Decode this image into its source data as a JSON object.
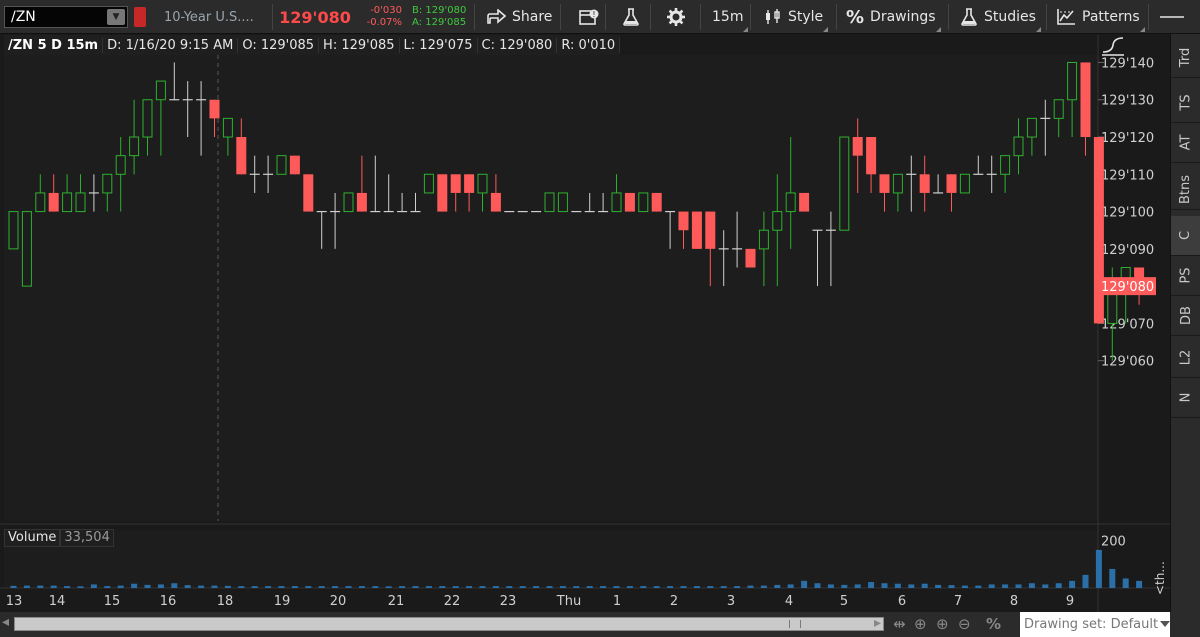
{
  "toolbar": {
    "symbol": "/ZN",
    "description": "10-Year U.S....",
    "last_price": "129'080",
    "change_net": "-0'030",
    "change_pct": "-0.07%",
    "bid": "B: 129'080",
    "ask": "A: 129'085",
    "share_label": "Share",
    "timeframe_label": "15m",
    "style_label": "Style",
    "drawings_label": "Drawings",
    "studies_label": "Studies",
    "patterns_label": "Patterns"
  },
  "chart_header": {
    "title": "/ZN 5 D 15m",
    "date": "D: 1/16/20 9:15 AM",
    "open": "O: 129'085",
    "high": "H: 129'085",
    "low": "L: 129'075",
    "close": "C: 129'080",
    "range": "R: 0'010"
  },
  "volume_header": {
    "label": "Volume",
    "value": "33,504"
  },
  "side_panel": {
    "tabs": [
      "Trd",
      "TS",
      "AT",
      "Btns",
      "C",
      "PS",
      "DB",
      "L2",
      "N"
    ],
    "selected": "C"
  },
  "bottom_bar": {
    "drawing_set": "Drawing set: Default"
  },
  "vol_axis_tick_labels": [
    "200",
    "<th..."
  ],
  "colors": {
    "up": "#2fb12f",
    "down": "#ff5a5a",
    "doji": "#cfcfcf",
    "volume": "#2a6fa8",
    "last_price_tag": "#ff5a5a"
  },
  "chart_data": {
    "type": "candlestick",
    "price_tick_labels": [
      "129'140",
      "129'130",
      "129'120",
      "129'110",
      "129'100",
      "129'090",
      "129'080",
      "129'070",
      "129'060"
    ],
    "price_ylim": [
      129.053125,
      129.44375
    ],
    "last_price_tag": "129'080",
    "x_tick_labels": [
      "13",
      "14",
      "15",
      "16",
      "18",
      "19",
      "20",
      "21",
      "22",
      "23",
      "Thu",
      "1",
      "2",
      "3",
      "4",
      "5",
      "6",
      "7",
      "8",
      "9"
    ],
    "volume_ylim": [
      0,
      235
    ],
    "candles": [
      {
        "o": 129.28125,
        "h": 129.3125,
        "l": 129.28125,
        "c": 129.3125
      },
      {
        "o": 129.25,
        "h": 129.3125,
        "l": 129.25,
        "c": 129.3125
      },
      {
        "o": 129.3125,
        "h": 129.34375,
        "l": 129.3125,
        "c": 129.328125
      },
      {
        "o": 129.328125,
        "h": 129.34375,
        "l": 129.3125,
        "c": 129.3125
      },
      {
        "o": 129.3125,
        "h": 129.34375,
        "l": 129.3125,
        "c": 129.328125
      },
      {
        "o": 129.3125,
        "h": 129.34375,
        "l": 129.3125,
        "c": 129.328125
      },
      {
        "o": 129.328125,
        "h": 129.34375,
        "l": 129.3125,
        "c": 129.328125
      },
      {
        "o": 129.328125,
        "h": 129.34375,
        "l": 129.3125,
        "c": 129.34375
      },
      {
        "o": 129.34375,
        "h": 129.375,
        "l": 129.3125,
        "c": 129.359375
      },
      {
        "o": 129.359375,
        "h": 129.40625,
        "l": 129.34375,
        "c": 129.375
      },
      {
        "o": 129.375,
        "h": 129.40625,
        "l": 129.359375,
        "c": 129.40625
      },
      {
        "o": 129.40625,
        "h": 129.421875,
        "l": 129.359375,
        "c": 129.421875
      },
      {
        "o": 129.40625,
        "h": 129.4375,
        "l": 129.40625,
        "c": 129.40625
      },
      {
        "o": 129.40625,
        "h": 129.421875,
        "l": 129.375,
        "c": 129.40625
      },
      {
        "o": 129.40625,
        "h": 129.421875,
        "l": 129.359375,
        "c": 129.40625
      },
      {
        "o": 129.40625,
        "h": 129.40625,
        "l": 129.375,
        "c": 129.390625
      },
      {
        "o": 129.375,
        "h": 129.390625,
        "l": 129.359375,
        "c": 129.390625
      },
      {
        "o": 129.375,
        "h": 129.390625,
        "l": 129.34375,
        "c": 129.34375
      },
      {
        "o": 129.34375,
        "h": 129.359375,
        "l": 129.328125,
        "c": 129.34375
      },
      {
        "o": 129.34375,
        "h": 129.359375,
        "l": 129.328125,
        "c": 129.34375
      },
      {
        "o": 129.34375,
        "h": 129.359375,
        "l": 129.34375,
        "c": 129.359375
      },
      {
        "o": 129.359375,
        "h": 129.359375,
        "l": 129.34375,
        "c": 129.34375
      },
      {
        "o": 129.34375,
        "h": 129.34375,
        "l": 129.3125,
        "c": 129.3125
      },
      {
        "o": 129.3125,
        "h": 129.3125,
        "l": 129.28125,
        "c": 129.3125
      },
      {
        "o": 129.3125,
        "h": 129.328125,
        "l": 129.28125,
        "c": 129.3125
      },
      {
        "o": 129.3125,
        "h": 129.328125,
        "l": 129.3125,
        "c": 129.328125
      },
      {
        "o": 129.328125,
        "h": 129.359375,
        "l": 129.3125,
        "c": 129.3125
      },
      {
        "o": 129.3125,
        "h": 129.359375,
        "l": 129.3125,
        "c": 129.3125
      },
      {
        "o": 129.3125,
        "h": 129.34375,
        "l": 129.3125,
        "c": 129.3125
      },
      {
        "o": 129.3125,
        "h": 129.328125,
        "l": 129.3125,
        "c": 129.3125
      },
      {
        "o": 129.3125,
        "h": 129.328125,
        "l": 129.3125,
        "c": 129.3125
      },
      {
        "o": 129.328125,
        "h": 129.34375,
        "l": 129.328125,
        "c": 129.34375
      },
      {
        "o": 129.34375,
        "h": 129.34375,
        "l": 129.3125,
        "c": 129.3125
      },
      {
        "o": 129.34375,
        "h": 129.34375,
        "l": 129.3125,
        "c": 129.328125
      },
      {
        "o": 129.34375,
        "h": 129.34375,
        "l": 129.3125,
        "c": 129.328125
      },
      {
        "o": 129.328125,
        "h": 129.34375,
        "l": 129.3125,
        "c": 129.34375
      },
      {
        "o": 129.328125,
        "h": 129.34375,
        "l": 129.3125,
        "c": 129.3125
      },
      {
        "o": 129.3125,
        "h": 129.3125,
        "l": 129.3125,
        "c": 129.3125
      },
      {
        "o": 129.3125,
        "h": 129.3125,
        "l": 129.3125,
        "c": 129.3125
      },
      {
        "o": 129.3125,
        "h": 129.3125,
        "l": 129.3125,
        "c": 129.3125
      },
      {
        "o": 129.3125,
        "h": 129.328125,
        "l": 129.3125,
        "c": 129.328125
      },
      {
        "o": 129.3125,
        "h": 129.328125,
        "l": 129.3125,
        "c": 129.328125
      },
      {
        "o": 129.3125,
        "h": 129.3125,
        "l": 129.3125,
        "c": 129.3125
      },
      {
        "o": 129.3125,
        "h": 129.328125,
        "l": 129.3125,
        "c": 129.3125
      },
      {
        "o": 129.3125,
        "h": 129.328125,
        "l": 129.3125,
        "c": 129.3125
      },
      {
        "o": 129.3125,
        "h": 129.34375,
        "l": 129.3125,
        "c": 129.328125
      },
      {
        "o": 129.328125,
        "h": 129.328125,
        "l": 129.3125,
        "c": 129.3125
      },
      {
        "o": 129.3125,
        "h": 129.328125,
        "l": 129.3125,
        "c": 129.328125
      },
      {
        "o": 129.328125,
        "h": 129.328125,
        "l": 129.3125,
        "c": 129.3125
      },
      {
        "o": 129.3125,
        "h": 129.3125,
        "l": 129.28125,
        "c": 129.3125
      },
      {
        "o": 129.3125,
        "h": 129.3125,
        "l": 129.28125,
        "c": 129.296875
      },
      {
        "o": 129.3125,
        "h": 129.3125,
        "l": 129.28125,
        "c": 129.28125
      },
      {
        "o": 129.3125,
        "h": 129.3125,
        "l": 129.25,
        "c": 129.28125
      },
      {
        "o": 129.28125,
        "h": 129.296875,
        "l": 129.25,
        "c": 129.28125
      },
      {
        "o": 129.28125,
        "h": 129.3125,
        "l": 129.265625,
        "c": 129.28125
      },
      {
        "o": 129.28125,
        "h": 129.28125,
        "l": 129.265625,
        "c": 129.265625
      },
      {
        "o": 129.28125,
        "h": 129.3125,
        "l": 129.25,
        "c": 129.296875
      },
      {
        "o": 129.296875,
        "h": 129.34375,
        "l": 129.25,
        "c": 129.3125
      },
      {
        "o": 129.3125,
        "h": 129.375,
        "l": 129.28125,
        "c": 129.328125
      },
      {
        "o": 129.328125,
        "h": 129.328125,
        "l": 129.3125,
        "c": 129.3125
      },
      {
        "o": 129.296875,
        "h": 129.296875,
        "l": 129.25,
        "c": 129.296875
      },
      {
        "o": 129.296875,
        "h": 129.3125,
        "l": 129.25,
        "c": 129.296875
      },
      {
        "o": 129.296875,
        "h": 129.375,
        "l": 129.296875,
        "c": 129.375
      },
      {
        "o": 129.375,
        "h": 129.390625,
        "l": 129.328125,
        "c": 129.359375
      },
      {
        "o": 129.375,
        "h": 129.375,
        "l": 129.328125,
        "c": 129.34375
      },
      {
        "o": 129.34375,
        "h": 129.34375,
        "l": 129.3125,
        "c": 129.328125
      },
      {
        "o": 129.328125,
        "h": 129.34375,
        "l": 129.3125,
        "c": 129.34375
      },
      {
        "o": 129.34375,
        "h": 129.359375,
        "l": 129.3125,
        "c": 129.34375
      },
      {
        "o": 129.34375,
        "h": 129.359375,
        "l": 129.3125,
        "c": 129.328125
      },
      {
        "o": 129.328125,
        "h": 129.34375,
        "l": 129.328125,
        "c": 129.328125
      },
      {
        "o": 129.34375,
        "h": 129.34375,
        "l": 129.3125,
        "c": 129.328125
      },
      {
        "o": 129.328125,
        "h": 129.34375,
        "l": 129.328125,
        "c": 129.34375
      },
      {
        "o": 129.34375,
        "h": 129.359375,
        "l": 129.34375,
        "c": 129.34375
      },
      {
        "o": 129.34375,
        "h": 129.359375,
        "l": 129.328125,
        "c": 129.34375
      },
      {
        "o": 129.34375,
        "h": 129.359375,
        "l": 129.328125,
        "c": 129.359375
      },
      {
        "o": 129.359375,
        "h": 129.390625,
        "l": 129.34375,
        "c": 129.375
      },
      {
        "o": 129.375,
        "h": 129.390625,
        "l": 129.359375,
        "c": 129.390625
      },
      {
        "o": 129.390625,
        "h": 129.40625,
        "l": 129.359375,
        "c": 129.390625
      },
      {
        "o": 129.390625,
        "h": 129.40625,
        "l": 129.375,
        "c": 129.40625
      },
      {
        "o": 129.40625,
        "h": 129.4375,
        "l": 129.375,
        "c": 129.4375
      },
      {
        "o": 129.4375,
        "h": 129.4375,
        "l": 129.359375,
        "c": 129.375
      },
      {
        "o": 129.375,
        "h": 129.375,
        "l": 129.21875,
        "c": 129.21875
      },
      {
        "o": 129.21875,
        "h": 129.265625,
        "l": 129.1875,
        "c": 129.25
      },
      {
        "o": 129.25,
        "h": 129.265625,
        "l": 129.21875,
        "c": 129.265625
      },
      {
        "o": 129.265625,
        "h": 129.265625,
        "l": 129.234375,
        "c": 129.25
      }
    ],
    "volume": [
      9,
      10,
      10,
      10,
      8,
      7,
      15,
      8,
      10,
      18,
      13,
      15,
      20,
      12,
      10,
      10,
      9,
      8,
      8,
      8,
      8,
      8,
      8,
      8,
      8,
      8,
      8,
      8,
      7,
      8,
      8,
      8,
      8,
      8,
      8,
      8,
      8,
      8,
      8,
      8,
      8,
      8,
      8,
      8,
      8,
      8,
      8,
      8,
      8,
      8,
      8,
      8,
      8,
      8,
      8,
      10,
      10,
      13,
      15,
      30,
      20,
      15,
      13,
      15,
      25,
      20,
      18,
      15,
      18,
      13,
      12,
      10,
      10,
      15,
      15,
      15,
      20,
      15,
      20,
      30,
      55,
      160,
      80,
      40,
      30
    ]
  }
}
